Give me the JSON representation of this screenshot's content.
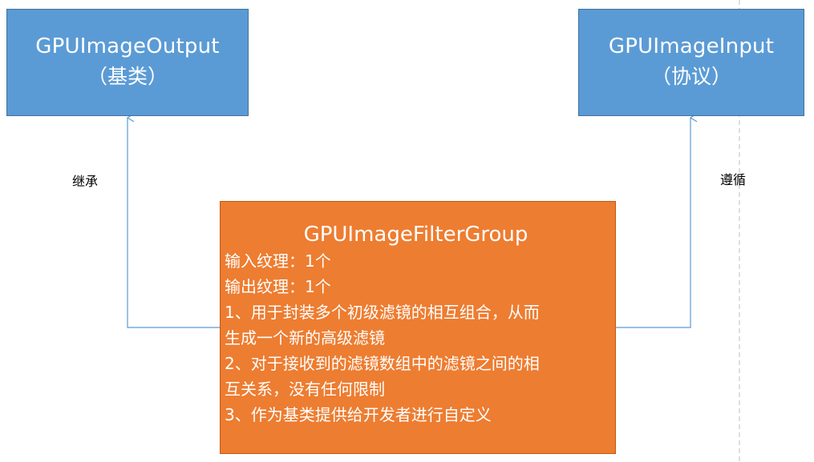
{
  "nodes": {
    "output": {
      "title": "GPUImageOutput",
      "subtitle": "（基类）"
    },
    "input": {
      "title": "GPUImageInput",
      "subtitle": "（协议）"
    },
    "filter_group": {
      "title": "GPUImageFilterGroup",
      "lines": [
        "输入纹理：1个",
        "输出纹理：1个",
        "1、用于封装多个初级滤镜的相互组合，从而",
        "生成一个新的高级滤镜",
        "2、对于接收到的滤镜数组中的滤镜之间的相",
        "互关系，没有任何限制",
        "3、作为基类提供给开发者进行自定义"
      ]
    }
  },
  "edges": {
    "inherit_label": "继承",
    "conform_label": "遵循"
  },
  "colors": {
    "blue_fill": "#5b9bd5",
    "orange_fill": "#ed7d31",
    "connector": "#5b9bd5",
    "divider": "#bfbfbf"
  }
}
